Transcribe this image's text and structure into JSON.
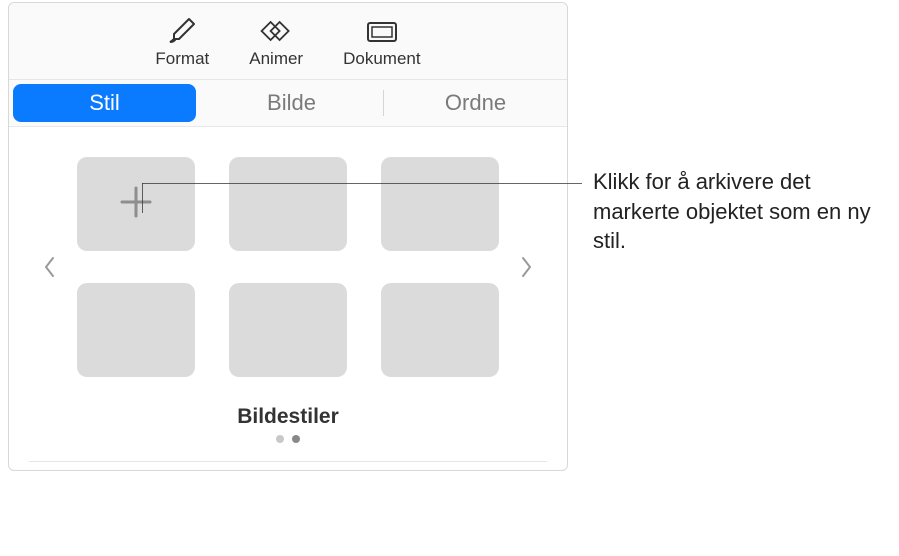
{
  "toolbar": {
    "format": {
      "label": "Format"
    },
    "animate": {
      "label": "Animer"
    },
    "document": {
      "label": "Dokument"
    }
  },
  "tabs": {
    "style": "Stil",
    "image": "Bilde",
    "arrange": "Ordne"
  },
  "styles_section": {
    "title": "Bildestiler"
  },
  "callout": {
    "text": "Klikk for å arkivere det markerte objektet som en ny stil."
  }
}
